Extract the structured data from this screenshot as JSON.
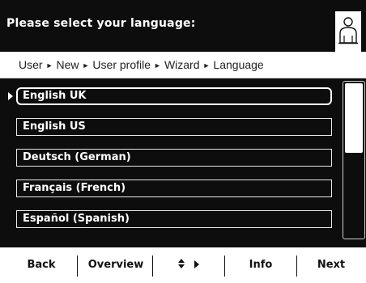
{
  "header": {
    "title": "Please select your language:",
    "user_icon": "user-icon"
  },
  "breadcrumb": {
    "items": [
      "User",
      "New",
      "User profile",
      "Wizard",
      "Language"
    ],
    "separator": "►"
  },
  "language_list": {
    "selected_index": 0,
    "items": [
      "English UK",
      "English US",
      "Deutsch (German)",
      "Français (French)",
      "Español (Spanish)"
    ]
  },
  "scrollbar": {
    "thumb_fraction": 0.45,
    "thumb_position": 0
  },
  "softkeys": {
    "back": "Back",
    "overview": "Overview",
    "navigate_icons": "up-down-arrow-icon, right-arrow-icon",
    "info": "Info",
    "next": "Next"
  },
  "colors": {
    "panel_background": "#0d0d0d",
    "text_light": "#ffffff",
    "text_dark": "#111111"
  }
}
